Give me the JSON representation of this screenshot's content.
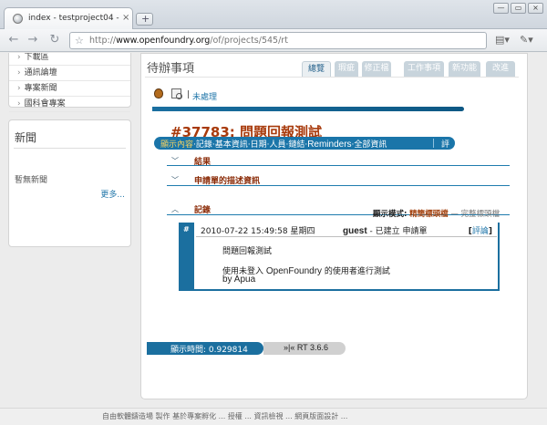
{
  "browser": {
    "tab_title": "index - testproject04 - O...",
    "tab_close": "×",
    "new_tab": "+",
    "url_host": "www.openfoundry.org",
    "url_prefix": "http://",
    "url_path": "/of/projects/545/rt",
    "window_buttons": [
      "—",
      "▭",
      "×"
    ],
    "nav": {
      "back": "←",
      "forward": "→",
      "reload": "↻"
    },
    "icons": {
      "star": "star-icon",
      "page_menu": "page-menu-icon",
      "wrench": "wrench-icon"
    }
  },
  "sidebar": {
    "items": [
      {
        "label": "下載區"
      },
      {
        "label": "通訊論壇"
      },
      {
        "label": "專案新聞"
      },
      {
        "label": "國科會專案"
      }
    ],
    "news": {
      "title": "新聞",
      "empty": "暫無新聞",
      "more": "更多..."
    }
  },
  "main": {
    "heading": "待辦事項",
    "tabs": [
      {
        "label": "總覽",
        "active": true
      },
      {
        "label": "瑕疵",
        "active": false
      },
      {
        "label": "修正檔",
        "active": false
      },
      {
        "label": "工作事項",
        "active": false
      },
      {
        "label": "新功能",
        "active": false
      },
      {
        "label": "改進",
        "active": false
      }
    ],
    "subnav": {
      "sep": "|",
      "link": "未處理"
    },
    "ticket": {
      "title": "#37783: 問題回報測試",
      "menu": {
        "display": "顯示內容",
        "items": "‧記錄‧基本資訊‧日期‧人員‧鏈結‧",
        "reminders": "Reminders",
        "all": "‧全部資訊",
        "extra": "評論"
      },
      "sections": [
        {
          "title": "結果"
        },
        {
          "title": "申請單的描述資訊"
        },
        {
          "title": "記錄"
        }
      ],
      "display_mode": {
        "label": "顯示模式:",
        "on": "精簡標頭檔",
        "dash": "—",
        "off": "完整標頭檔"
      },
      "history": {
        "marker": "#",
        "date": "2010-07-22 15:49:58 星期四",
        "who_name": "guest",
        "who_action": "- 已建立 申請單",
        "reply_open": "[",
        "reply": "評論",
        "reply_close": "]",
        "line1": "問題回報測試",
        "line2_pre": "使用未登入 ",
        "line2_en": "OpenFoundry",
        "line2_post": " 的使用者進行測試",
        "line3": "by Apua"
      }
    },
    "footer": {
      "time_label": "顯示時間: 0.929814",
      "rt_label": "»|« RT 3.6.6"
    }
  },
  "page_footer": "自由軟體鑄造場 製作 基於專案孵化 ... 授權 ... 資訊檢視 ... 網頁版面設計 ..."
}
